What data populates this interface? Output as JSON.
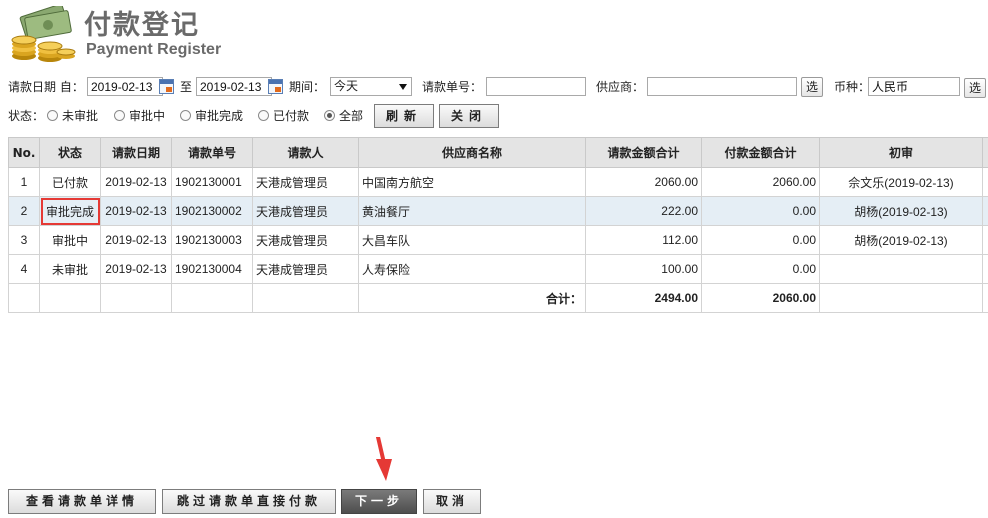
{
  "header": {
    "title_cn": "付款登记",
    "title_en": "Payment Register"
  },
  "filters": {
    "date_label": "请款日期 自：",
    "date_from": "2019-02-13",
    "to_label": "至",
    "date_to": "2019-02-13",
    "period_label": "期间：",
    "period_value": "今天",
    "request_no_label": "请款单号：",
    "request_no_value": "",
    "supplier_label": "供应商：",
    "supplier_value": "",
    "select_label": "选",
    "currency_label": "币种：",
    "currency_value": "人民币",
    "currency_select_label": "选"
  },
  "status_filter": {
    "label": "状态：",
    "options": [
      {
        "label": "未审批",
        "selected": false
      },
      {
        "label": "审批中",
        "selected": false
      },
      {
        "label": "审批完成",
        "selected": false
      },
      {
        "label": "已付款",
        "selected": false
      },
      {
        "label": "全部",
        "selected": true
      }
    ],
    "refresh_label": "刷新",
    "close_label": "关闭"
  },
  "table": {
    "columns": [
      "No.",
      "状态",
      "请款日期",
      "请款单号",
      "请款人",
      "供应商名称",
      "请款金额合计",
      "付款金额合计",
      "初审"
    ],
    "rows": [
      {
        "no": "1",
        "status": "已付款",
        "date": "2019-02-13",
        "number": "1902130001",
        "requester": "天港成管理员",
        "supplier": "中国南方航空",
        "request_amount": "2060.00",
        "pay_amount": "2060.00",
        "first_review": "佘文乐(2019-02-13)"
      },
      {
        "no": "2",
        "status": "审批完成",
        "date": "2019-02-13",
        "number": "1902130002",
        "requester": "天港成管理员",
        "supplier": "黄油餐厅",
        "request_amount": "222.00",
        "pay_amount": "0.00",
        "first_review": "胡杨(2019-02-13)"
      },
      {
        "no": "3",
        "status": "审批中",
        "date": "2019-02-13",
        "number": "1902130003",
        "requester": "天港成管理员",
        "supplier": "大昌车队",
        "request_amount": "112.00",
        "pay_amount": "0.00",
        "first_review": "胡杨(2019-02-13)"
      },
      {
        "no": "4",
        "status": "未审批",
        "date": "2019-02-13",
        "number": "1902130004",
        "requester": "天港成管理员",
        "supplier": "人寿保险",
        "request_amount": "100.00",
        "pay_amount": "0.00",
        "first_review": ""
      }
    ],
    "total_label": "合计：",
    "total_request": "2494.00",
    "total_pay": "2060.00"
  },
  "actions": {
    "view_detail": "查看请款单详情",
    "skip": "跳过请款单直接付款",
    "next": "下一步",
    "cancel": "取消"
  },
  "colors": {
    "highlight": "#e53935",
    "selected_row": "#e5eef5",
    "next_button": "#555555"
  }
}
